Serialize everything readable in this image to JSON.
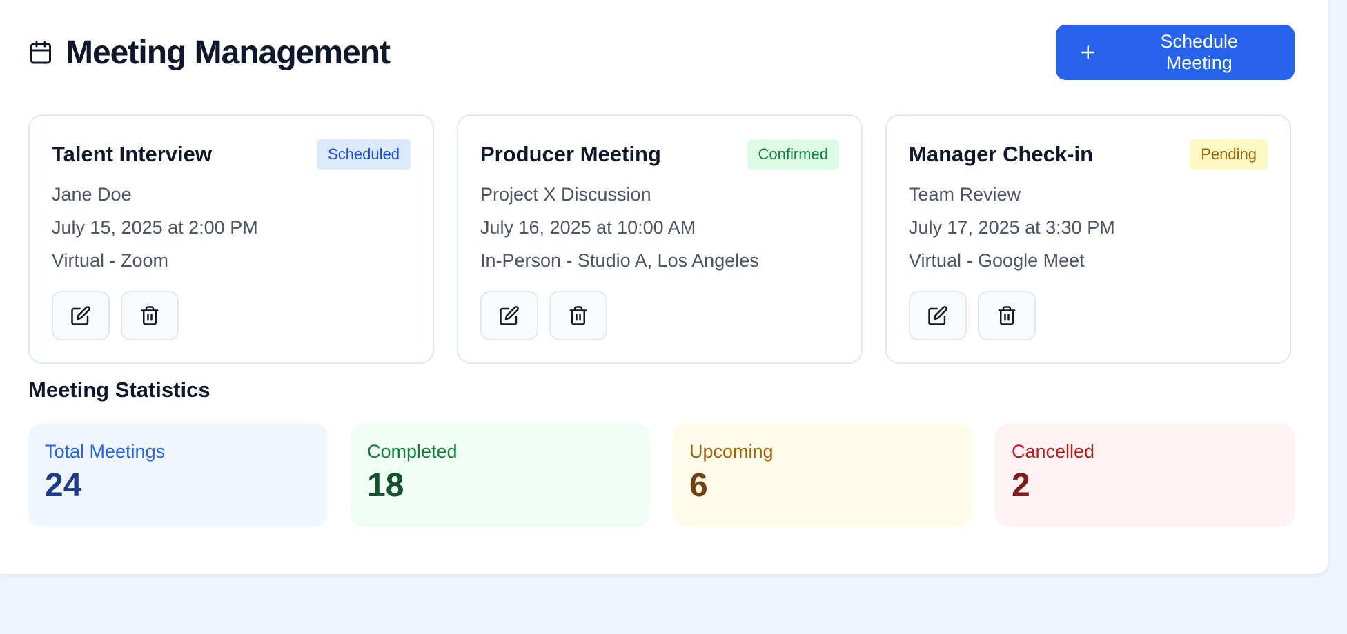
{
  "header": {
    "title": "Meeting Management",
    "title_icon": "calendar-icon",
    "schedule_button": {
      "label": "Schedule Meeting",
      "icon": "plus-icon"
    }
  },
  "meetings": [
    {
      "title": "Talent Interview",
      "status": "Scheduled",
      "status_color": "#1d4ed8",
      "with": "Jane Doe",
      "datetime": "July 15, 2025 at 2:00 PM",
      "location": "Virtual - Zoom"
    },
    {
      "title": "Producer Meeting",
      "status": "Confirmed",
      "status_color": "#15803d",
      "with": "Project X Discussion",
      "datetime": "July 16, 2025 at 10:00 AM",
      "location": "In-Person - Studio A, Los Angeles"
    },
    {
      "title": "Manager Check-in",
      "status": "Pending",
      "status_color": "#a16207",
      "with": "Team Review",
      "datetime": "July 17, 2025 at 3:30 PM",
      "location": "Virtual - Google Meet"
    }
  ],
  "card_actions": {
    "edit_icon": "edit-icon",
    "delete_icon": "trash-icon"
  },
  "statistics": {
    "title": "Meeting Statistics",
    "items": [
      {
        "label": "Total Meetings",
        "value": "24",
        "color": "#2563eb"
      },
      {
        "label": "Completed",
        "value": "18",
        "color": "#15803d"
      },
      {
        "label": "Upcoming",
        "value": "6",
        "color": "#a16207"
      },
      {
        "label": "Cancelled",
        "value": "2",
        "color": "#b91c1c"
      }
    ]
  },
  "colors": {
    "accent": "#2563eb",
    "background": "#eef3fd"
  }
}
